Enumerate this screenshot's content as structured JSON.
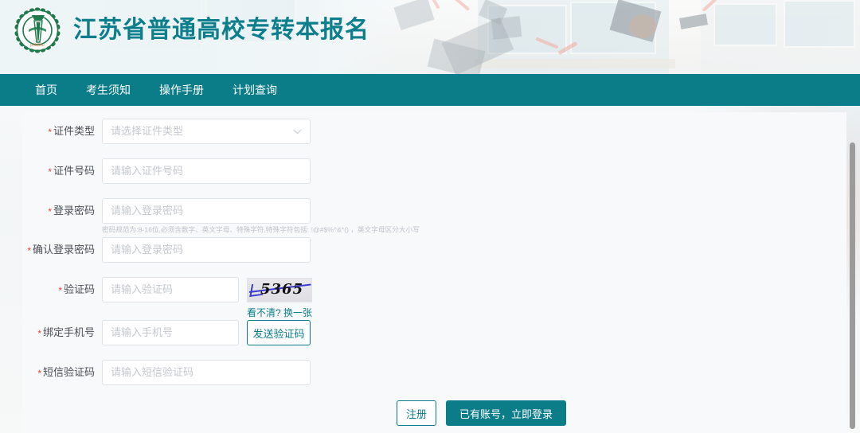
{
  "header": {
    "title": "江苏省普通高校专转本报名",
    "logo_icon": "emblem-laurel-wreath-icon",
    "banner_image": "graduation-caps-photo"
  },
  "nav": {
    "items": [
      {
        "label": "首页",
        "name": "nav-item-home"
      },
      {
        "label": "考生须知",
        "name": "nav-item-notice"
      },
      {
        "label": "操作手册",
        "name": "nav-item-manual"
      },
      {
        "label": "计划查询",
        "name": "nav-item-plan-query"
      }
    ]
  },
  "form": {
    "fields": [
      {
        "label": "证件类型",
        "required": true,
        "value": "",
        "placeholder": "请选择证件类型",
        "type": "select",
        "chevron": "chevron-down-icon"
      },
      {
        "label": "证件号码",
        "required": true,
        "value": "",
        "placeholder": "请输入证件号码",
        "type": "text"
      },
      {
        "label": "登录密码",
        "required": true,
        "value": "",
        "placeholder": "请输入登录密码",
        "type": "password",
        "hint": "密码规范为:8-16位,必须含数字、英文字母、特殊字符,特殊字符包括: !@#$%^&*() ，英文字母区分大小写"
      },
      {
        "label": "确认登录密码",
        "required": true,
        "value": "",
        "placeholder": "请输入登录密码",
        "type": "password"
      },
      {
        "label": "验证码",
        "required": true,
        "value": "",
        "placeholder": "请输入验证码",
        "type": "text"
      },
      {
        "label": "绑定手机号",
        "required": true,
        "value": "",
        "placeholder": "请输入手机号",
        "type": "text"
      },
      {
        "label": "短信验证码",
        "required": true,
        "value": "",
        "placeholder": "请输入短信验证码",
        "type": "text"
      }
    ],
    "captcha": {
      "code": "5365",
      "refresh_label": "看不清? 换一张"
    },
    "send_sms_label": "发送验证码",
    "register_label": "注册",
    "login_label": "已有账号，立即登录",
    "required_marker": "*"
  },
  "colors": {
    "brand_teal": "#0b7d89",
    "title_teal": "#0d7e8c",
    "required_red": "#e8453c",
    "page_bg": "#eceff1",
    "panel_bg": "#f7f9fb"
  }
}
